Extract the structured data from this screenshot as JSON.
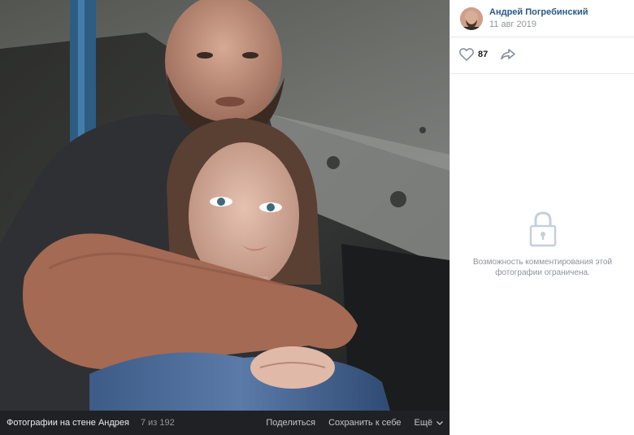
{
  "author": {
    "name": "Андрей Погребинский",
    "date": "11 авг 2019"
  },
  "post": {
    "likes": "87"
  },
  "comments": {
    "restricted_message": "Возможность комментирования этой фотографии ограничена."
  },
  "footer": {
    "album": "Фотографии на стене Андрея",
    "counter": "7 из 192",
    "share": "Поделиться",
    "save": "Сохранить к себе",
    "more": "Ещё"
  },
  "icons": {
    "like": "heart-icon",
    "share": "share-arrow-icon",
    "lock": "lock-icon",
    "more": "chevron-down-icon"
  },
  "colors": {
    "link": "#2a5885",
    "muted": "#939699",
    "footer_bg": "#202124"
  }
}
